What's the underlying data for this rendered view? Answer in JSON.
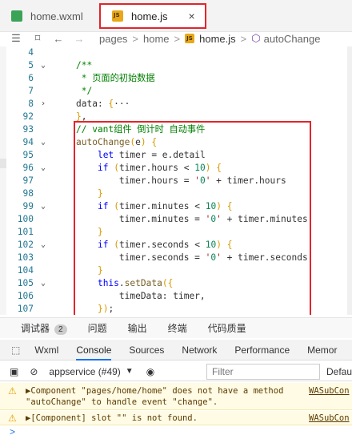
{
  "tabs": [
    {
      "label": "home.wxml",
      "icon": "wxml-file-icon"
    },
    {
      "label": "home.js",
      "icon": "js-file-icon",
      "close": "×"
    }
  ],
  "breadcrumb": {
    "items": [
      "pages",
      "home",
      "home.js",
      "autoChange"
    ],
    "sep": ">"
  },
  "editor": {
    "lines": [
      {
        "n": "4",
        "fold": "",
        "code": ""
      },
      {
        "n": "5",
        "fold": "v",
        "code": "/**"
      },
      {
        "n": "6",
        "fold": "",
        "code": " * 页面的初始数据"
      },
      {
        "n": "7",
        "fold": "",
        "code": " */"
      },
      {
        "n": "8",
        "fold": ">",
        "code": "data: {···"
      },
      {
        "n": "92",
        "fold": "",
        "code": "},"
      },
      {
        "n": "93",
        "fold": "",
        "code": "// vant组件 倒计时 自动事件"
      },
      {
        "n": "94",
        "fold": "v",
        "code": "autoChange(e) {"
      },
      {
        "n": "95",
        "fold": "",
        "code": "    let timer = e.detail"
      },
      {
        "n": "96",
        "fold": "v",
        "code": "    if (timer.hours < 10) {"
      },
      {
        "n": "97",
        "fold": "",
        "code": "        timer.hours = '0' + timer.hours"
      },
      {
        "n": "98",
        "fold": "",
        "code": "    }"
      },
      {
        "n": "99",
        "fold": "v",
        "code": "    if (timer.minutes < 10) {"
      },
      {
        "n": "100",
        "fold": "",
        "code": "        timer.minutes = '0' + timer.minutes"
      },
      {
        "n": "101",
        "fold": "",
        "code": "    }"
      },
      {
        "n": "102",
        "fold": "v",
        "code": "    if (timer.seconds < 10) {"
      },
      {
        "n": "103",
        "fold": "",
        "code": "        timer.seconds = '0' + timer.seconds"
      },
      {
        "n": "104",
        "fold": "",
        "code": "    }"
      },
      {
        "n": "105",
        "fold": "v",
        "code": "    this.setData({"
      },
      {
        "n": "106",
        "fold": "",
        "code": "        timeData: timer,"
      },
      {
        "n": "107",
        "fold": "",
        "code": "    });"
      }
    ]
  },
  "panel": {
    "tabs": [
      "调试器",
      "问题",
      "输出",
      "终端",
      "代码质量"
    ],
    "badge": "2"
  },
  "devtools": {
    "tabs": [
      "Wxml",
      "Console",
      "Sources",
      "Network",
      "Performance",
      "Memor"
    ],
    "active": "Console"
  },
  "console": {
    "context": "appservice (#49)",
    "filter_placeholder": "Filter",
    "level": "Defau",
    "messages": [
      {
        "text": "▶Component \"pages/home/home\" does not have a method\n\"autoChange\" to handle event \"change\".",
        "source": "WASubCon"
      },
      {
        "text": "▶[Component] slot \"\" is not found.",
        "source": "WASubCon"
      }
    ],
    "prompt": ">"
  },
  "colors": {
    "highlight": "#e3242b",
    "warning_bg": "#fffbe5"
  }
}
